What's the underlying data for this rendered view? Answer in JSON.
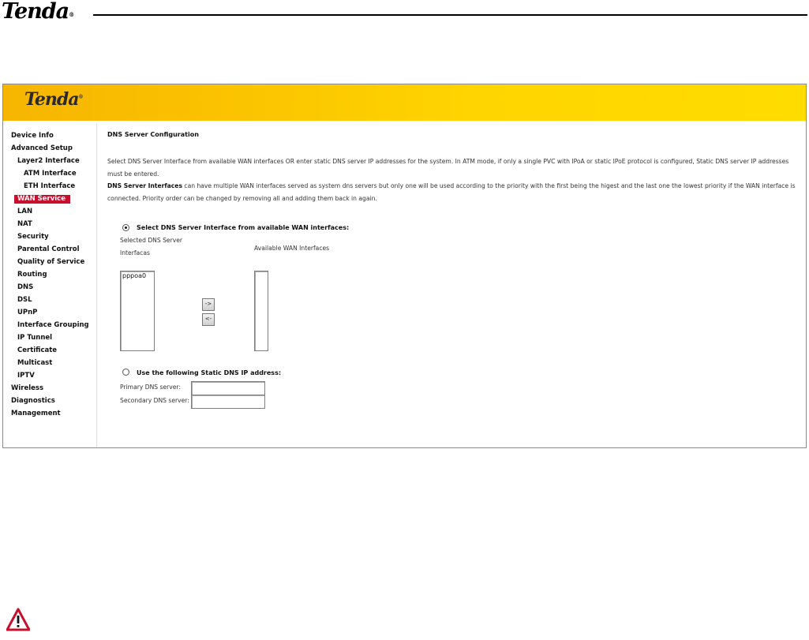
{
  "document": {
    "brand": "Tenda",
    "brand_mark": "®"
  },
  "banner": {
    "brand": "Tenda",
    "brand_mark": "®"
  },
  "sidebar": {
    "items": [
      {
        "label": "Device Info"
      },
      {
        "label": "Advanced Setup"
      },
      {
        "label": "Layer2 Interface"
      },
      {
        "label": "ATM Interface"
      },
      {
        "label": "ETH Interface"
      },
      {
        "label": "WAN Service",
        "active": true
      },
      {
        "label": "LAN"
      },
      {
        "label": "NAT"
      },
      {
        "label": "Security"
      },
      {
        "label": "Parental Control"
      },
      {
        "label": "Quality of Service"
      },
      {
        "label": "Routing"
      },
      {
        "label": "DNS"
      },
      {
        "label": "DSL"
      },
      {
        "label": "UPnP"
      },
      {
        "label": "Interface Grouping"
      },
      {
        "label": "IP Tunnel"
      },
      {
        "label": "Certificate"
      },
      {
        "label": "Multicast"
      },
      {
        "label": "IPTV"
      },
      {
        "label": "Wireless"
      },
      {
        "label": "Diagnostics"
      },
      {
        "label": "Management"
      }
    ]
  },
  "main": {
    "title": "DNS Server Configuration",
    "intro": "Select DNS Server Interface from available WAN interfaces OR enter static DNS server IP addresses for the system. In ATM mode, if only a single PVC with IPoA or static IPoE protocol is configured, Static DNS server IP addresses must be entered.",
    "note_bold": "DNS Server Interfaces",
    "note_rest": " can have multiple WAN interfaces served as system dns servers but only one will be used according to the priority with the first being the higest and the last one the lowest priority if the WAN interface is connected. Priority order can be changed by removing all and adding them back in again.",
    "option_interface": {
      "label": "Select DNS Server Interface from available WAN interfaces:",
      "checked": true
    },
    "selected_header_line1": "Selected DNS Server",
    "selected_header_line2": "Interfacas",
    "available_header": "Available WAN Interfaces",
    "selected_items": [
      "pppoa0"
    ],
    "available_items": [],
    "move_right_label": "->",
    "move_left_label": "<-",
    "option_static": {
      "label": "Use the following Static DNS IP address:",
      "checked": false
    },
    "primary_label": "Primary DNS server:",
    "primary_value": "",
    "secondary_label": "Secondary DNS server:",
    "secondary_value": ""
  },
  "colors": {
    "banner_start": "#f7b500",
    "banner_end": "#ffdc00",
    "active_nav": "#c8102e",
    "warning": "#c8102e"
  },
  "icons": {
    "warning": "warning-triangle-icon"
  }
}
